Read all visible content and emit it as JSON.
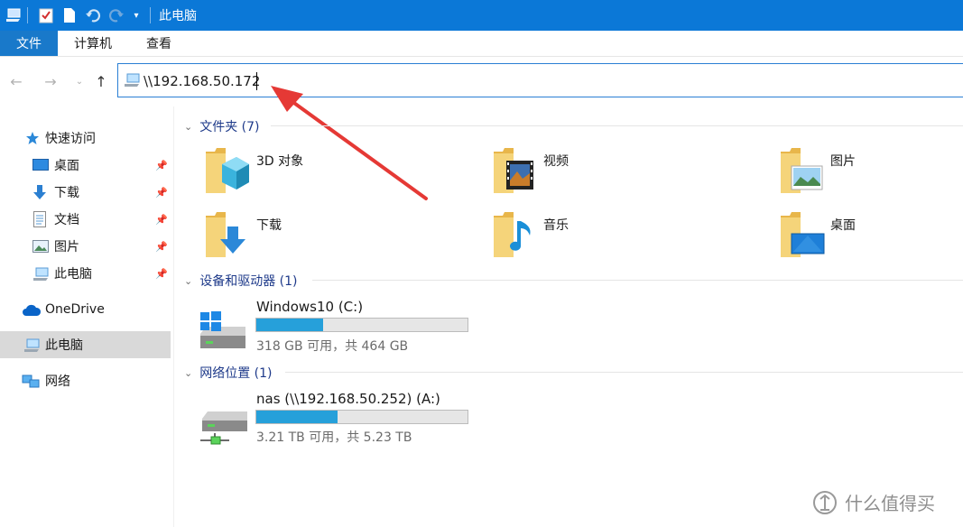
{
  "window": {
    "title": "此电脑"
  },
  "ribbon": {
    "tabs": [
      "文件",
      "计算机",
      "查看"
    ]
  },
  "address": {
    "value": "\\\\192.168.50.172"
  },
  "sidebar": {
    "quick_access": "快速访问",
    "pinned": [
      "桌面",
      "下载",
      "文档",
      "图片",
      "此电脑"
    ],
    "onedrive": "OneDrive",
    "this_pc": "此电脑",
    "network": "网络"
  },
  "groups": {
    "folders": "文件夹 (7)",
    "devices": "设备和驱动器 (1)",
    "network": "网络位置 (1)"
  },
  "folders": [
    "3D 对象",
    "视频",
    "图片",
    "下载",
    "音乐",
    "桌面"
  ],
  "drives": [
    {
      "name": "Windows10 (C:)",
      "sub": "318 GB 可用，共 464 GB",
      "used_fraction": 0.315
    },
    {
      "name": "nas (\\\\192.168.50.252) (A:)",
      "sub": "3.21 TB 可用，共 5.23 TB",
      "used_fraction": 0.386
    }
  ],
  "watermark": "什么值得买",
  "colors": {
    "accent": "#0b78d7",
    "annotation": "#e53935",
    "bar": "#26a0da"
  }
}
